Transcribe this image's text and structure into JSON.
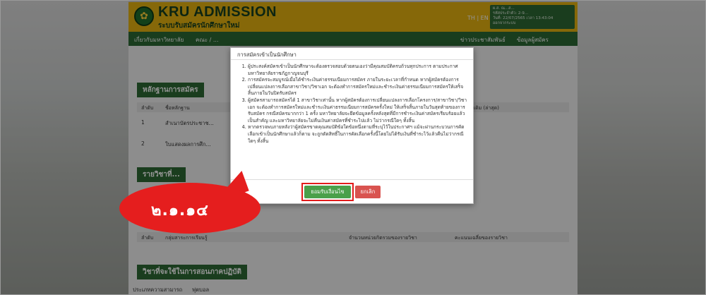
{
  "header": {
    "brand": "KRU ADMISSION",
    "brand_sub": "ระบบรับสมัครนักศึกษาใหม่",
    "lang": "TH | EN",
    "user_lines": [
      "ผ.ส. ณ...ส...",
      "รหัสประจำตัว: 2-9...",
      "วันที่: 22/07/2565 เวลา 13:43:04",
      "ออกจากระบบ"
    ]
  },
  "nav": {
    "items": [
      "เกี่ยวกับมหาวิทยาลัย",
      "คณะ / ...",
      "ข่าวประชาสัมพันธ์",
      "ข้อมูลผู้สมัคร"
    ]
  },
  "content": {
    "section1": "หลักฐานการสมัคร",
    "table1_headers": [
      "ลำดับ",
      "ชื่อหลักฐาน",
      "...เดิม (ล่าสุด)"
    ],
    "table1_rows": [
      [
        "1",
        "สำเนาบัตรประชาช..."
      ],
      [
        "2",
        "ใบแสดงผลการศึก..."
      ]
    ],
    "section2": "รายวิชาที่...",
    "table2_headers": [
      "ลำดับ",
      "กลุ่มสาระการเรียนรู้",
      "จำนวนหน่วยกิตรวมของรายวิชา",
      "คะแนนเฉลี่ยของรายวิชา"
    ],
    "section3": "วิชาที่จะใช้ในการสอนภาคปฏิบัติ",
    "bottom_row": [
      "ประเภทความสามารถ",
      "ฟุตบอล"
    ]
  },
  "modal": {
    "title": "การสมัครเข้าเป็นนักศึกษา",
    "items": [
      "ผู้ประสงค์สมัครเข้าเป็นนักศึกษาจะต้องตรวจสอบด้วยตนเองว่ามีคุณสมบัติครบถ้วนทุกประการ ตามประกาศมหาวิทยาลัยราชภัฏกาญจนบุรี",
      "การสมัครจะสมบูรณ์เมื่อได้ชำระเงินค่าธรรมเนียมการสมัคร ภายในระยะเวลาที่กำหนด หากผู้สมัครต้องการเปลี่ยนแปลงการเลือกสาขาวิชา/วิชาเอก จะต้องทำการสมัครใหม่และชำระเงินค่าธรรมเนียมการสมัครให้เสร็จสิ้นภายในวันปิดรับสมัคร",
      "ผู้สมัครสามารถสมัครได้ 1 สาขาวิชาเท่านั้น หากผู้สมัครต้องการเปลี่ยนแปลงการเลือกโครงการ/สาขาวิชา/วิชาเอก จะต้องทำการสมัครใหม่และชำระเงินค่าธรรมเนียมการสมัครครั้งใหม่ ให้เสร็จสิ้นภายในวันสุดท้ายของการรับสมัคร กรณีสมัครมากกว่า 1 ครั้ง มหาวิทยาลัยจะยึดข้อมูลครั้งหลังสุดที่มีการชำระเงินค่าสมัครเรียบร้อยแล้วเป็นสำคัญ และมหาวิทยาลัยจะไม่คืนเงินค่าสมัครที่ชำระไปแล้ว ไม่ว่ากรณีใดๆ ทั้งสิ้น",
      "หากตรวจพบภายหลังว่าผู้สมัครขาดคุณสมบัติข้อใดข้อหนึ่งตามที่ระบุไว้ในประกาศฯ แม้จะผ่านกระบวนการคัดเลือกเข้าเป็นนักศึกษาแล้วก็ตาม จะถูกตัดสิทธิ์ในการคัดเลือกครั้งนี้โดยไม่ได้รับเงินที่ชำระไว้แล้วคืนไม่ว่ากรณีใดๆ ทั้งสิ้น"
    ],
    "accept_label": "ยอมรับเงื่อนไข",
    "cancel_label": "ยกเลิก"
  },
  "callout": {
    "text": "๒.๑.๑๔"
  },
  "colors": {
    "header_yellow": "#e7b410",
    "nav_green": "#2c6a34",
    "accept_green": "#4aa04a",
    "cancel_red": "#d9534f",
    "callout_red": "#e51e1e"
  }
}
